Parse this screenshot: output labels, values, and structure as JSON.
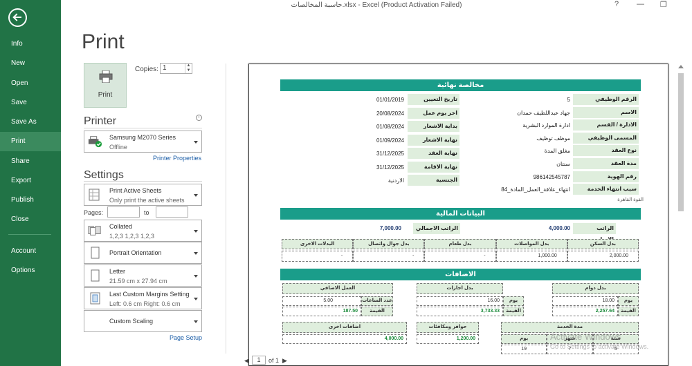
{
  "window": {
    "title": "حاسبة المخالصات.xlsx - Excel (Product Activation Failed)",
    "help_glyph": "?",
    "minimize_glyph": "—",
    "restore_glyph": "❐"
  },
  "sidebar": {
    "items": [
      {
        "label": "Info"
      },
      {
        "label": "New"
      },
      {
        "label": "Open"
      },
      {
        "label": "Save"
      },
      {
        "label": "Save As"
      },
      {
        "label": "Print"
      },
      {
        "label": "Share"
      },
      {
        "label": "Export"
      },
      {
        "label": "Publish"
      },
      {
        "label": "Close"
      },
      {
        "label": "Account"
      },
      {
        "label": "Options"
      }
    ],
    "active": "Print"
  },
  "print_panel": {
    "heading": "Print",
    "print_button": "Print",
    "copies_label": "Copies:",
    "copies_value": "1",
    "printer_heading": "Printer",
    "printer_name": "Samsung M2070 Series",
    "printer_status": "Offline",
    "printer_properties": "Printer Properties",
    "settings_heading": "Settings",
    "print_what": "Print Active Sheets",
    "print_what_desc": "Only print the active sheets",
    "pages_label": "Pages:",
    "to_label": "to",
    "collate": "Collated",
    "collate_desc": "1,2,3   1,2,3   1,2,3",
    "orientation": "Portrait Orientation",
    "paper": "Letter",
    "paper_desc": "21.59 cm x 27.94 cm",
    "margins": "Last Custom Margins Setting",
    "margins_desc": "Left:  0.6 cm    Right:  0.6 cm",
    "scaling": "Custom Scaling",
    "page_setup": "Page Setup"
  },
  "pager": {
    "current": "1",
    "of": "of 1"
  },
  "activation": {
    "line1": "Activate Windows",
    "line2": "Go to Settings to activate Windows."
  },
  "sheet": {
    "title": "مخالصة نهائية",
    "right_fields": [
      {
        "label": "الرقم الوظيفي",
        "value": "5"
      },
      {
        "label": "الاسم",
        "value": "جهاد عبداللطيف حمدان"
      },
      {
        "label": "الادارة / القسم",
        "value": "ادارة الموارد البشرية"
      },
      {
        "label": "المسمى الوظيفي",
        "value": "موظف توظيف"
      },
      {
        "label": "نوع العقد",
        "value": "مغلق المدة"
      },
      {
        "label": "مدة العقد",
        "value": "سنتان"
      },
      {
        "label": "رقم الهوية",
        "value": "986142545787"
      },
      {
        "label": "سبب انتهاء الخدمة",
        "value": "انتهاء_علاقة_العمل_المادة_84"
      }
    ],
    "reason_note": "القوة القاهرة",
    "left_fields": [
      {
        "label": "تاريخ التعيين",
        "value": "01/01/2019"
      },
      {
        "label": "اخر يوم عمل",
        "value": "20/08/2024"
      },
      {
        "label": "بداية الاشعار",
        "value": "01/08/2024"
      },
      {
        "label": "نهاية الاشعار",
        "value": "01/09/2024"
      },
      {
        "label": "نهاية العقد",
        "value": "31/12/2025"
      },
      {
        "label": "نهاية الاقامة",
        "value": "31/12/2025"
      },
      {
        "label": "الجنسية",
        "value": "الاردنية"
      }
    ],
    "finance_title": "البيانات المالية",
    "basic_salary_label": "الراتب الاساسي",
    "basic_salary": "4,000.00",
    "total_salary_label": "الراتب الاجمالي",
    "total_salary": "7,000.00",
    "allowances_headers": [
      "بدل السكن",
      "بدل المواصلات",
      "بدل طعام",
      "بدل جوال واتصال",
      "البدلات الاخرى"
    ],
    "allowances_values": [
      "2,000.00",
      "1,000.00",
      "-",
      "-",
      "-"
    ],
    "additions_title": "الاضافات",
    "attendance": {
      "title": "بدل دوام",
      "day_label": "يوم",
      "days": "18.00",
      "value_label": "القيمة",
      "value": "2,257.64"
    },
    "leave": {
      "title": "بدل اجازات",
      "day_label": "يوم",
      "days": "16.00",
      "value_label": "القيمة",
      "value": "3,733.33"
    },
    "overtime": {
      "title": "العمل الاضافي",
      "hours_label": "عدد الساعات",
      "hours": "5.00",
      "value_label": "القيمة",
      "value": "187.50"
    },
    "service": {
      "title": "مدة الخدمة",
      "headers": [
        "سنة",
        "شهر",
        "يوم"
      ],
      "values": [
        "5",
        "7",
        "19"
      ]
    },
    "bonus": {
      "title": "حوافز ومكافئات",
      "value": "1,200.00"
    },
    "other": {
      "title": "اضافات اخرى",
      "value": "4,000.00"
    }
  }
}
